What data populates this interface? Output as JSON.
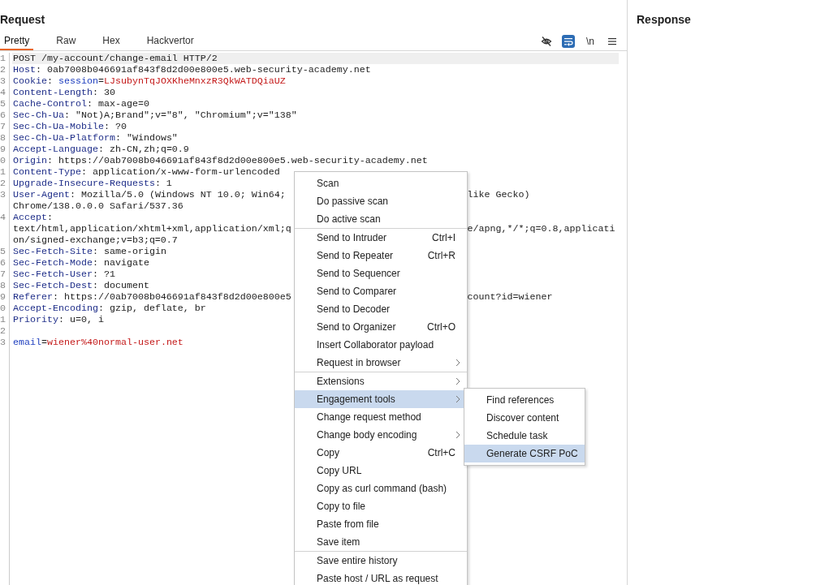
{
  "request": {
    "title": "Request",
    "tabs": [
      {
        "label": "Pretty",
        "selected": true
      },
      {
        "label": "Raw",
        "selected": false
      },
      {
        "label": "Hex",
        "selected": false
      },
      {
        "label": "Hackvertor",
        "selected": false
      }
    ],
    "toolbar": [
      {
        "kind": "eye-off",
        "on": false
      },
      {
        "kind": "text",
        "label": "\\n",
        "on": false
      },
      {
        "kind": "menu",
        "on": false
      }
    ],
    "wrap_button": {
      "on": true
    },
    "lines": [
      {
        "number": "1",
        "current": true,
        "parts": [
          {
            "text": "POST /my-account/change-email HTTP/2",
            "kind": "plain"
          }
        ]
      },
      {
        "number": "2",
        "current": false,
        "parts": [
          {
            "text": "Host",
            "kind": "key"
          },
          {
            "text": ": 0ab7008b046691af843f8d2d00e800e5.web-security-academy.net",
            "kind": "plain"
          }
        ]
      },
      {
        "number": "3",
        "current": false,
        "parts": [
          {
            "text": "Cookie",
            "kind": "key"
          },
          {
            "text": ": ",
            "kind": "plain"
          },
          {
            "text": "session",
            "kind": "param"
          },
          {
            "text": "=",
            "kind": "plain"
          },
          {
            "text": "LJsubynTqJOXKheMnxzR3QkWATDQiaUZ",
            "kind": "value"
          }
        ]
      },
      {
        "number": "4",
        "current": false,
        "parts": [
          {
            "text": "Content-Length",
            "kind": "key"
          },
          {
            "text": ": 30",
            "kind": "plain"
          }
        ]
      },
      {
        "number": "5",
        "current": false,
        "parts": [
          {
            "text": "Cache-Control",
            "kind": "key"
          },
          {
            "text": ": max-age=0",
            "kind": "plain"
          }
        ]
      },
      {
        "number": "6",
        "current": false,
        "parts": [
          {
            "text": "Sec-Ch-Ua",
            "kind": "key"
          },
          {
            "text": ": \"Not)A;Brand\";v=\"8\", \"Chromium\";v=\"138\"",
            "kind": "plain"
          }
        ]
      },
      {
        "number": "7",
        "current": false,
        "parts": [
          {
            "text": "Sec-Ch-Ua-Mobile",
            "kind": "key"
          },
          {
            "text": ": ?0",
            "kind": "plain"
          }
        ]
      },
      {
        "number": "8",
        "current": false,
        "parts": [
          {
            "text": "Sec-Ch-Ua-Platform",
            "kind": "key"
          },
          {
            "text": ": \"Windows\"",
            "kind": "plain"
          }
        ]
      },
      {
        "number": "9",
        "current": false,
        "parts": [
          {
            "text": "Accept-Language",
            "kind": "key"
          },
          {
            "text": ": zh-CN,zh;q=0.9",
            "kind": "plain"
          }
        ]
      },
      {
        "number": "0",
        "current": false,
        "parts": [
          {
            "text": "Origin",
            "kind": "key"
          },
          {
            "text": ": https://0ab7008b046691af843f8d2d00e800e5.web-security-academy.net",
            "kind": "plain"
          }
        ]
      },
      {
        "number": "1",
        "current": false,
        "parts": [
          {
            "text": "Content-Type",
            "kind": "key"
          },
          {
            "text": ": application/x-www-form-urlencoded",
            "kind": "plain"
          }
        ]
      },
      {
        "number": "2",
        "current": false,
        "parts": [
          {
            "text": "Upgrade-Insecure-Requests",
            "kind": "key"
          },
          {
            "text": ": 1",
            "kind": "plain"
          }
        ]
      },
      {
        "number": "3",
        "current": false,
        "parts": [
          {
            "text": "User-Agent",
            "kind": "key"
          },
          {
            "text": ": Mozilla/5.0 (Windows NT 10.0; Win64;",
            "kind": "plain"
          }
        ],
        "resume": [
          {
            "text": "like Gecko)",
            "kind": "plain"
          }
        ]
      },
      {
        "current": false,
        "parts": [
          {
            "text": "Chrome/138.0.0.0 Safari/537.36",
            "kind": "plain"
          }
        ]
      },
      {
        "number": "4",
        "current": false,
        "parts": [
          {
            "text": "Accept",
            "kind": "key"
          },
          {
            "text": ":",
            "kind": "plain"
          }
        ]
      },
      {
        "current": false,
        "parts": [
          {
            "text": "text/html,application/xhtml+xml,application/xml;q",
            "kind": "plain"
          }
        ],
        "resume": [
          {
            "text": "e/apng,*/*;q=0.8,applicati",
            "kind": "plain"
          }
        ]
      },
      {
        "current": false,
        "parts": [
          {
            "text": "on/signed-exchange;v=b3;q=0.7",
            "kind": "plain"
          }
        ]
      },
      {
        "number": "5",
        "current": false,
        "parts": [
          {
            "text": "Sec-Fetch-Site",
            "kind": "key"
          },
          {
            "text": ": same-origin",
            "kind": "plain"
          }
        ]
      },
      {
        "number": "6",
        "current": false,
        "parts": [
          {
            "text": "Sec-Fetch-Mode",
            "kind": "key"
          },
          {
            "text": ": navigate",
            "kind": "plain"
          }
        ]
      },
      {
        "number": "7",
        "current": false,
        "parts": [
          {
            "text": "Sec-Fetch-User",
            "kind": "key"
          },
          {
            "text": ": ?1",
            "kind": "plain"
          }
        ]
      },
      {
        "number": "8",
        "current": false,
        "parts": [
          {
            "text": "Sec-Fetch-Dest",
            "kind": "key"
          },
          {
            "text": ": document",
            "kind": "plain"
          }
        ]
      },
      {
        "number": "9",
        "current": false,
        "parts": [
          {
            "text": "Referer",
            "kind": "key"
          },
          {
            "text": ": https://0ab7008b046691af843f8d2d00e800e5",
            "kind": "plain"
          }
        ],
        "resume": [
          {
            "text": "count?id=wiener",
            "kind": "plain"
          }
        ]
      },
      {
        "number": "0",
        "current": false,
        "parts": [
          {
            "text": "Accept-Encoding",
            "kind": "key"
          },
          {
            "text": ": gzip, deflate, br",
            "kind": "plain"
          }
        ]
      },
      {
        "number": "1",
        "current": false,
        "parts": [
          {
            "text": "Priority",
            "kind": "key"
          },
          {
            "text": ": u=0, i",
            "kind": "plain"
          }
        ]
      },
      {
        "number": "2",
        "current": false
      },
      {
        "number": "3",
        "current": false,
        "parts": [
          {
            "text": "email",
            "kind": "param"
          },
          {
            "text": "=",
            "kind": "plain"
          },
          {
            "text": "wiener%40normal-user.net",
            "kind": "value"
          }
        ]
      }
    ]
  },
  "response": {
    "title": "Response"
  },
  "context_menu": {
    "items": [
      {
        "kind": "item",
        "label": "Scan",
        "selected": false,
        "submenu": false
      },
      {
        "kind": "item",
        "label": "Do passive scan",
        "selected": false,
        "submenu": false
      },
      {
        "kind": "item",
        "label": "Do active scan",
        "selected": false,
        "submenu": false
      },
      {
        "kind": "separator"
      },
      {
        "kind": "item",
        "label": "Send to Intruder",
        "shortcut": "Ctrl+I",
        "selected": false,
        "submenu": false
      },
      {
        "kind": "item",
        "label": "Send to Repeater",
        "shortcut": "Ctrl+R",
        "selected": false,
        "submenu": false
      },
      {
        "kind": "item",
        "label": "Send to Sequencer",
        "selected": false,
        "submenu": false
      },
      {
        "kind": "item",
        "label": "Send to Comparer",
        "selected": false,
        "submenu": false
      },
      {
        "kind": "item",
        "label": "Send to Decoder",
        "selected": false,
        "submenu": false
      },
      {
        "kind": "item",
        "label": "Send to Organizer",
        "shortcut": "Ctrl+O",
        "selected": false,
        "submenu": false
      },
      {
        "kind": "item",
        "label": "Insert Collaborator payload",
        "selected": false,
        "submenu": false
      },
      {
        "kind": "item",
        "label": "Request in browser",
        "selected": false,
        "submenu": true
      },
      {
        "kind": "separator"
      },
      {
        "kind": "item",
        "label": "Extensions",
        "selected": false,
        "submenu": true
      },
      {
        "kind": "item",
        "label": "Engagement tools",
        "selected": true,
        "submenu": true
      },
      {
        "kind": "item",
        "label": "Change request method",
        "selected": false,
        "submenu": false
      },
      {
        "kind": "item",
        "label": "Change body encoding",
        "selected": false,
        "submenu": true
      },
      {
        "kind": "item",
        "label": "Copy",
        "shortcut": "Ctrl+C",
        "selected": false,
        "submenu": false
      },
      {
        "kind": "item",
        "label": "Copy URL",
        "selected": false,
        "submenu": false
      },
      {
        "kind": "item",
        "label": "Copy as curl command (bash)",
        "selected": false,
        "submenu": false
      },
      {
        "kind": "item",
        "label": "Copy to file",
        "selected": false,
        "submenu": false
      },
      {
        "kind": "item",
        "label": "Paste from file",
        "selected": false,
        "submenu": false
      },
      {
        "kind": "item",
        "label": "Save item",
        "selected": false,
        "submenu": false
      },
      {
        "kind": "separator"
      },
      {
        "kind": "item",
        "label": "Save entire history",
        "selected": false,
        "submenu": false
      },
      {
        "kind": "item",
        "label": "Paste host / URL as request",
        "selected": false,
        "submenu": false
      }
    ],
    "submenu": [
      {
        "label": "Find references",
        "selected": false
      },
      {
        "label": "Discover content",
        "selected": false
      },
      {
        "label": "Schedule task",
        "selected": false
      },
      {
        "label": "Generate CSRF PoC",
        "selected": true
      }
    ]
  }
}
